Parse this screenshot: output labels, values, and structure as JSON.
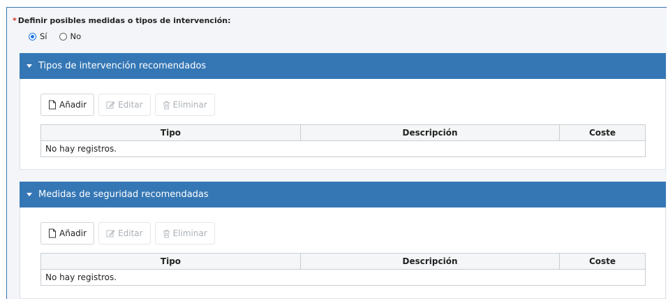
{
  "question": {
    "required_mark": "*",
    "label": "Definir posibles medidas o tipos de intervención:",
    "options": [
      {
        "label": "Sí",
        "checked": true
      },
      {
        "label": "No",
        "checked": false
      }
    ]
  },
  "panels": [
    {
      "title": "Tipos de intervención recomendados",
      "toolbar": {
        "add": "Añadir",
        "edit": "Editar",
        "delete": "Eliminar"
      },
      "columns": [
        "Tipo",
        "Descripción",
        "Coste"
      ],
      "empty_text": "No hay registros."
    },
    {
      "title": "Medidas de seguridad recomendadas",
      "toolbar": {
        "add": "Añadir",
        "edit": "Editar",
        "delete": "Eliminar"
      },
      "columns": [
        "Tipo",
        "Descripción",
        "Coste"
      ],
      "empty_text": "No hay registros."
    }
  ],
  "colors": {
    "header": "#3577b5",
    "radio_accent": "#1a73e8",
    "required": "#d9302c"
  }
}
